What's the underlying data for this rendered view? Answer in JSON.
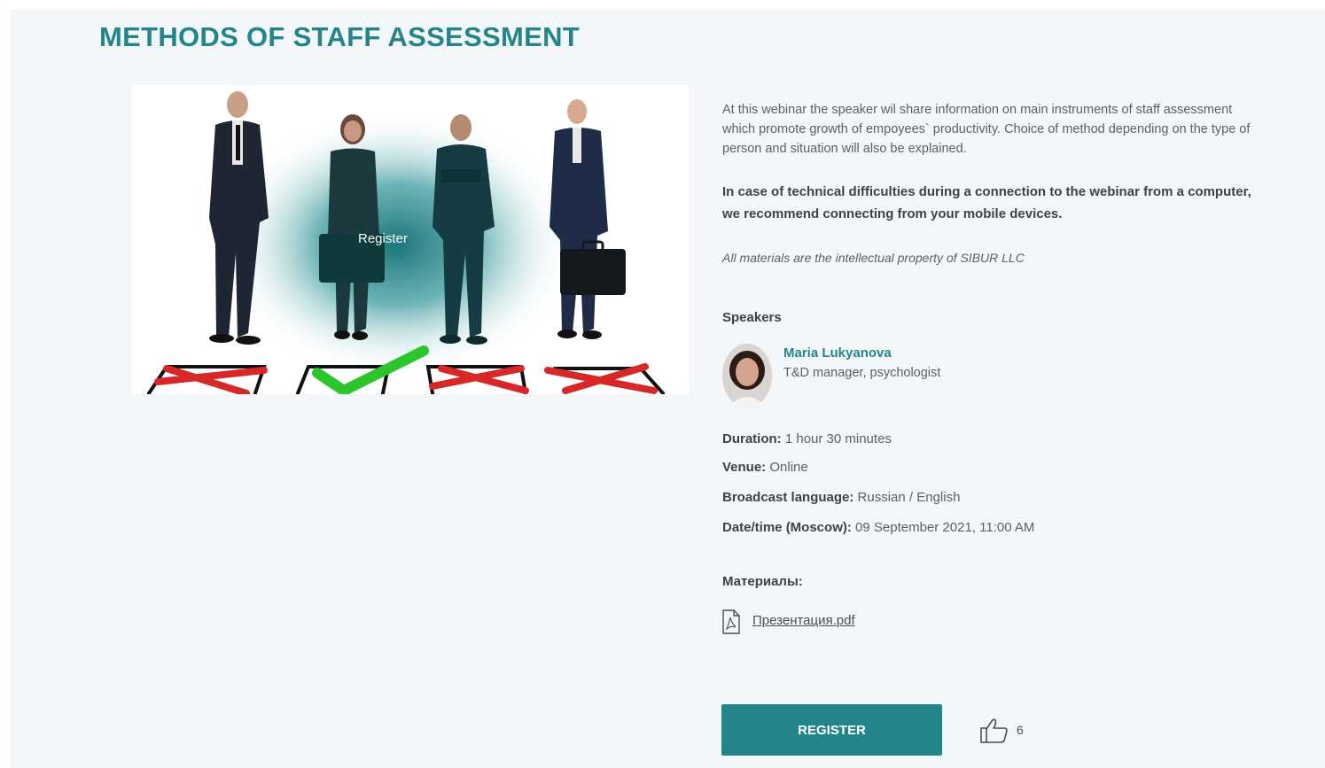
{
  "page_title": "METHODS OF STAFF ASSESSMENT",
  "video": {
    "play_label": "Register"
  },
  "description": "At this webinar the speaker wil share information on main instruments of staff assessment which promote growth of empoyees` productivity. Choice of method depending on the type of person and situation will also be explained.",
  "technical_note": "In case of technical difficulties during a connection to the webinar from a computer, we recommend connecting from your mobile devices.",
  "ip_note": "All materials are the intellectual property of SIBUR LLC",
  "speakers": {
    "heading": "Speakers",
    "items": [
      {
        "name": "Maria Lukyanova",
        "role": "T&D manager, psychologist"
      }
    ]
  },
  "details": {
    "duration_label": "Duration:",
    "duration_value": " 1 hour 30 minutes",
    "venue_label": "Venue:",
    "venue_value": " Online",
    "language_label": "Broadcast language:",
    "language_value": " Russian / English",
    "datetime_label": "Date/time (Moscow):",
    "datetime_value": " 09 September 2021, 11:00 AM"
  },
  "materials": {
    "heading": "Материалы:",
    "file_name": "Презентация.pdf"
  },
  "actions": {
    "register_label": "REGISTER",
    "likes_count": "6"
  },
  "colors": {
    "accent": "#23858a",
    "background": "#f4f7fa",
    "check_green": "#2cc52c",
    "cross_red": "#d62828"
  },
  "icons": {
    "play": "play-icon",
    "pdf": "pdf-file-icon",
    "like": "thumbs-up-icon"
  }
}
